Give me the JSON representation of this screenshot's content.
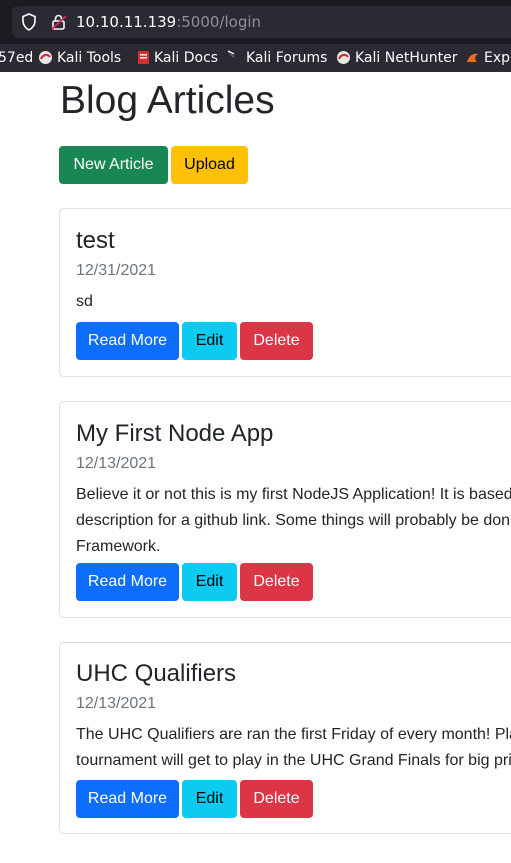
{
  "browser": {
    "url_host": "10.10.11.139",
    "url_path": ":5000/login",
    "bookmarks": [
      {
        "label": "57ed",
        "icon": "none"
      },
      {
        "label": "Kali Tools",
        "icon": "kali-icon"
      },
      {
        "label": "Kali Docs",
        "icon": "kali-docs-icon"
      },
      {
        "label": "Kali Forums",
        "icon": "kali-dragon-icon"
      },
      {
        "label": "Kali NetHunter",
        "icon": "kali-icon"
      },
      {
        "label": "Expl",
        "icon": "exploit-db-icon"
      }
    ]
  },
  "page": {
    "title": "Blog Articles",
    "new_article_label": "New Article",
    "upload_label": "Upload"
  },
  "articles": [
    {
      "title": "test",
      "date": "12/31/2021",
      "lines": [
        "sd"
      ],
      "read_more": "Read More",
      "edit": "Edit",
      "delete": "Delete"
    },
    {
      "title": "My First Node App",
      "date": "12/13/2021",
      "lines": [
        "Believe it or not this is my first NodeJS Application! It is based",
        "description for a github link. Some things will probably be don",
        "Framework."
      ],
      "read_more": "Read More",
      "edit": "Edit",
      "delete": "Delete"
    },
    {
      "title": "UHC Qualifiers",
      "date": "12/13/2021",
      "lines": [
        "The UHC Qualifiers are ran the first Friday of every month! Pla",
        "tournament will get to play in the UHC Grand Finals for big pri"
      ],
      "read_more": "Read More",
      "edit": "Edit",
      "delete": "Delete"
    }
  ],
  "colors": {
    "success": "#198754",
    "warning": "#ffc107",
    "primary": "#0d6efd",
    "info": "#0dcaf0",
    "danger": "#dc3545"
  }
}
